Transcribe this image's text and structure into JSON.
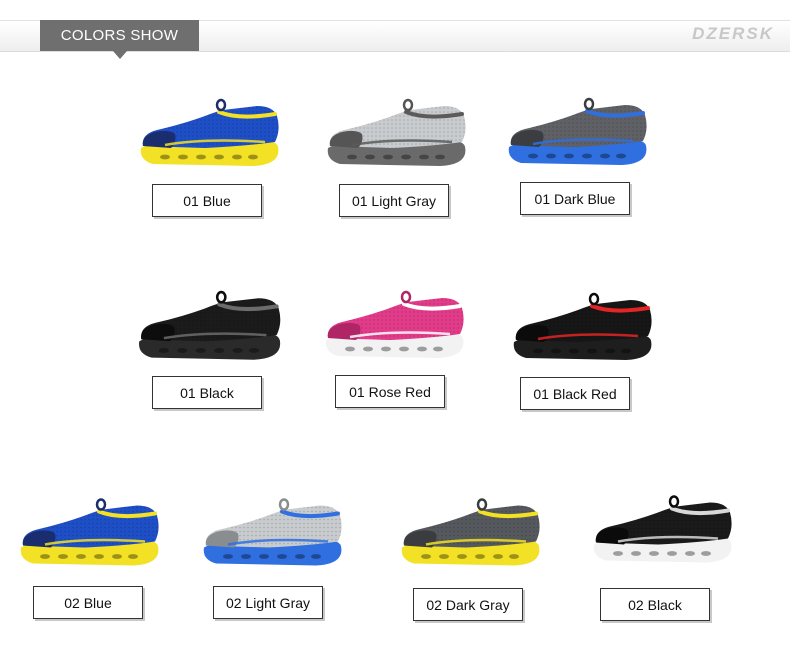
{
  "header": {
    "tab_label": "COLORS SHOW",
    "brand": "DZERSK"
  },
  "products": [
    {
      "label": "01 Blue",
      "upper": "#1f4fc6",
      "sole": "#f2e124",
      "accent": "#f2e124",
      "dark": "#1a2d6e"
    },
    {
      "label": "01 Light Gray",
      "upper": "#c9cccf",
      "sole": "#6a6a6a",
      "accent": "#5b5b5b",
      "dark": "#555555"
    },
    {
      "label": "01 Dark Blue",
      "upper": "#5f6166",
      "sole": "#2f6fe0",
      "accent": "#2f6fe0",
      "dark": "#3c3d41"
    },
    {
      "label": "01 Black",
      "upper": "#1b1b1b",
      "sole": "#2a2a2a",
      "accent": "#6c6c6c",
      "dark": "#0d0d0d"
    },
    {
      "label": "01 Rose Red",
      "upper": "#e23b8a",
      "sole": "#f2f2f2",
      "accent": "#ffffff",
      "dark": "#b02566"
    },
    {
      "label": "01 Black Red",
      "upper": "#161616",
      "sole": "#1e1e1e",
      "accent": "#e32525",
      "dark": "#0b0b0b"
    },
    {
      "label": "02 Blue",
      "upper": "#1f4fc6",
      "sole": "#f2e124",
      "accent": "#f2e124",
      "dark": "#1a2d6e"
    },
    {
      "label": "02 Light Gray",
      "upper": "#c9cccf",
      "sole": "#2f6fe0",
      "accent": "#2f6fe0",
      "dark": "#8a8d90"
    },
    {
      "label": "02 Dark Gray",
      "upper": "#55585c",
      "sole": "#f2e124",
      "accent": "#f2e124",
      "dark": "#3a3c40"
    },
    {
      "label": "02 Black",
      "upper": "#1a1a1a",
      "sole": "#f2f2f2",
      "accent": "#d8d8d8",
      "dark": "#0b0b0b"
    }
  ]
}
